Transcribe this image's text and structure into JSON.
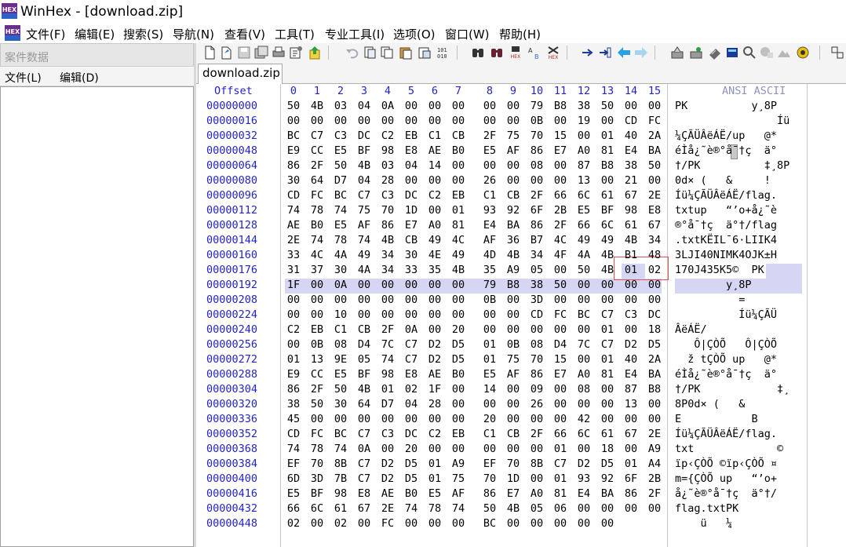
{
  "app": {
    "title": "WinHex - [download.zip]"
  },
  "menu": [
    {
      "name": "menu-file",
      "label": "文件(F)",
      "underline": "F"
    },
    {
      "name": "menu-edit",
      "label": "编辑(E)",
      "underline": "E"
    },
    {
      "name": "menu-search",
      "label": "搜索(S)",
      "underline": "S"
    },
    {
      "name": "menu-navigation",
      "label": "导航(N)",
      "underline": "N"
    },
    {
      "name": "menu-view",
      "label": "查看(V)",
      "underline": "V"
    },
    {
      "name": "menu-tools",
      "label": "工具(T)",
      "underline": "T"
    },
    {
      "name": "menu-specialist",
      "label": "专业工具(I)",
      "underline": "I"
    },
    {
      "name": "menu-options",
      "label": "选项(O)",
      "underline": "O"
    },
    {
      "name": "menu-window",
      "label": "窗口(W)",
      "underline": "W"
    },
    {
      "name": "menu-help",
      "label": "帮助(H)",
      "underline": "H"
    }
  ],
  "case_panel": {
    "caption": "案件数据",
    "menu_file": "文件(L)",
    "menu_edit": "编辑(D)"
  },
  "tab": {
    "label": "download.zip"
  },
  "hex": {
    "offset_header": "Offset",
    "column_headers": [
      "0",
      "1",
      "2",
      "3",
      "4",
      "5",
      "6",
      "7",
      "8",
      "9",
      "10",
      "11",
      "12",
      "13",
      "14",
      "15"
    ],
    "ascii_header": "ANSI ASCII",
    "rows": [
      {
        "offset": "00000000",
        "bytes": [
          "50",
          "4B",
          "03",
          "04",
          "0A",
          "00",
          "00",
          "00",
          "00",
          "00",
          "79",
          "B8",
          "38",
          "50",
          "00",
          "00"
        ],
        "ascii": "PK          y¸8P  "
      },
      {
        "offset": "00000016",
        "bytes": [
          "00",
          "00",
          "00",
          "00",
          "00",
          "00",
          "00",
          "00",
          "00",
          "00",
          "0B",
          "00",
          "19",
          "00",
          "CD",
          "FC"
        ],
        "ascii": "                Íü"
      },
      {
        "offset": "00000032",
        "bytes": [
          "BC",
          "C7",
          "C3",
          "DC",
          "C2",
          "EB",
          "C1",
          "CB",
          "2F",
          "75",
          "70",
          "15",
          "00",
          "01",
          "40",
          "2A"
        ],
        "ascii": "¼ÇÃÜÂëÁË/up   @*"
      },
      {
        "offset": "00000048",
        "bytes": [
          "E9",
          "CC",
          "E5",
          "BF",
          "98",
          "E8",
          "AE",
          "B0",
          "E5",
          "AF",
          "86",
          "E7",
          "A0",
          "81",
          "E4",
          "BA"
        ],
        "ascii": "éÌå¿˜è®°å¯†ç  ä°"
      },
      {
        "offset": "00000064",
        "bytes": [
          "86",
          "2F",
          "50",
          "4B",
          "03",
          "04",
          "14",
          "00",
          "00",
          "00",
          "08",
          "00",
          "87",
          "B8",
          "38",
          "50"
        ],
        "ascii": "†/PK          ‡¸8P"
      },
      {
        "offset": "00000080",
        "bytes": [
          "30",
          "64",
          "D7",
          "04",
          "28",
          "00",
          "00",
          "00",
          "26",
          "00",
          "00",
          "00",
          "13",
          "00",
          "21",
          "00"
        ],
        "ascii": "0d× (   &     !"
      },
      {
        "offset": "00000096",
        "bytes": [
          "CD",
          "FC",
          "BC",
          "C7",
          "C3",
          "DC",
          "C2",
          "EB",
          "C1",
          "CB",
          "2F",
          "66",
          "6C",
          "61",
          "67",
          "2E"
        ],
        "ascii": "Íü¼ÇÃÜÂëÁË/flag."
      },
      {
        "offset": "00000112",
        "bytes": [
          "74",
          "78",
          "74",
          "75",
          "70",
          "1D",
          "00",
          "01",
          "93",
          "92",
          "6F",
          "2B",
          "E5",
          "BF",
          "98",
          "E8"
        ],
        "ascii": "txtup   “’o+å¿˜è"
      },
      {
        "offset": "00000128",
        "bytes": [
          "AE",
          "B0",
          "E5",
          "AF",
          "86",
          "E7",
          "A0",
          "81",
          "E4",
          "BA",
          "86",
          "2F",
          "66",
          "6C",
          "61",
          "67"
        ],
        "ascii": "®°å¯†ç  ä°†/flag"
      },
      {
        "offset": "00000144",
        "bytes": [
          "2E",
          "74",
          "78",
          "74",
          "4B",
          "CB",
          "49",
          "4C",
          "AF",
          "36",
          "B7",
          "4C",
          "49",
          "49",
          "4B",
          "34"
        ],
        "ascii": ".txtKËIL¯6·LIIK4"
      },
      {
        "offset": "00000160",
        "bytes": [
          "33",
          "4C",
          "4A",
          "49",
          "34",
          "30",
          "4E",
          "49",
          "4D",
          "4B",
          "34",
          "4F",
          "4A",
          "4B",
          "B1",
          "48"
        ],
        "ascii": "3LJI40NIMK4OJK±H"
      },
      {
        "offset": "00000176",
        "bytes": [
          "31",
          "37",
          "30",
          "4A",
          "34",
          "33",
          "35",
          "4B",
          "35",
          "A9",
          "05",
          "00",
          "50",
          "4B",
          "01",
          "02"
        ],
        "ascii": "170J435K5©  PK  "
      },
      {
        "offset": "00000192",
        "bytes": [
          "1F",
          "00",
          "0A",
          "00",
          "00",
          "00",
          "00",
          "00",
          "79",
          "B8",
          "38",
          "50",
          "00",
          "00",
          "00",
          "00"
        ],
        "ascii": "        y¸8P    "
      },
      {
        "offset": "00000208",
        "bytes": [
          "00",
          "00",
          "00",
          "00",
          "00",
          "00",
          "00",
          "00",
          "0B",
          "00",
          "3D",
          "00",
          "00",
          "00",
          "00",
          "00"
        ],
        "ascii": "          =     "
      },
      {
        "offset": "00000224",
        "bytes": [
          "00",
          "00",
          "10",
          "00",
          "00",
          "00",
          "00",
          "00",
          "00",
          "00",
          "CD",
          "FC",
          "BC",
          "C7",
          "C3",
          "DC"
        ],
        "ascii": "          Íü¼ÇÃÜ"
      },
      {
        "offset": "00000240",
        "bytes": [
          "C2",
          "EB",
          "C1",
          "CB",
          "2F",
          "0A",
          "00",
          "20",
          "00",
          "00",
          "00",
          "00",
          "00",
          "01",
          "00",
          "18"
        ],
        "ascii": "ÂëÁË/           "
      },
      {
        "offset": "00000256",
        "bytes": [
          "00",
          "0B",
          "08",
          "D4",
          "7C",
          "C7",
          "D2",
          "D5",
          "01",
          "0B",
          "08",
          "D4",
          "7C",
          "C7",
          "D2",
          "D5"
        ],
        "ascii": "   Ô|ÇÒÕ   Ô|ÇÒÕ"
      },
      {
        "offset": "00000272",
        "bytes": [
          "01",
          "13",
          "9E",
          "05",
          "74",
          "C7",
          "D2",
          "D5",
          "01",
          "75",
          "70",
          "15",
          "00",
          "01",
          "40",
          "2A"
        ],
        "ascii": "  ž tÇÒÕ up   @*"
      },
      {
        "offset": "00000288",
        "bytes": [
          "E9",
          "CC",
          "E5",
          "BF",
          "98",
          "E8",
          "AE",
          "B0",
          "E5",
          "AF",
          "86",
          "E7",
          "A0",
          "81",
          "E4",
          "BA"
        ],
        "ascii": "éÌå¿˜è®°å¯†ç  ä°"
      },
      {
        "offset": "00000304",
        "bytes": [
          "86",
          "2F",
          "50",
          "4B",
          "01",
          "02",
          "1F",
          "00",
          "14",
          "00",
          "09",
          "00",
          "08",
          "00",
          "87",
          "B8"
        ],
        "ascii": "†/PK            ‡¸"
      },
      {
        "offset": "00000320",
        "bytes": [
          "38",
          "50",
          "30",
          "64",
          "D7",
          "04",
          "28",
          "00",
          "00",
          "00",
          "26",
          "00",
          "00",
          "00",
          "13",
          "00"
        ],
        "ascii": "8P0d× (   &     "
      },
      {
        "offset": "00000336",
        "bytes": [
          "45",
          "00",
          "00",
          "00",
          "00",
          "00",
          "00",
          "00",
          "20",
          "00",
          "00",
          "00",
          "42",
          "00",
          "00",
          "00"
        ],
        "ascii": "E           B   "
      },
      {
        "offset": "00000352",
        "bytes": [
          "CD",
          "FC",
          "BC",
          "C7",
          "C3",
          "DC",
          "C2",
          "EB",
          "C1",
          "CB",
          "2F",
          "66",
          "6C",
          "61",
          "67",
          "2E"
        ],
        "ascii": "Íü¼ÇÃÜÂëÁË/flag."
      },
      {
        "offset": "00000368",
        "bytes": [
          "74",
          "78",
          "74",
          "0A",
          "00",
          "20",
          "00",
          "00",
          "00",
          "00",
          "00",
          "01",
          "00",
          "18",
          "00",
          "A9"
        ],
        "ascii": "txt             ©"
      },
      {
        "offset": "00000384",
        "bytes": [
          "EF",
          "70",
          "8B",
          "C7",
          "D2",
          "D5",
          "01",
          "A9",
          "EF",
          "70",
          "8B",
          "C7",
          "D2",
          "D5",
          "01",
          "A4"
        ],
        "ascii": "ïp‹ÇÒÕ ©ïp‹ÇÒÕ ¤"
      },
      {
        "offset": "00000400",
        "bytes": [
          "6D",
          "3D",
          "7B",
          "C7",
          "D2",
          "D5",
          "01",
          "75",
          "70",
          "1D",
          "00",
          "01",
          "93",
          "92",
          "6F",
          "2B"
        ],
        "ascii": "m={ÇÒÕ up   “’o+"
      },
      {
        "offset": "00000416",
        "bytes": [
          "E5",
          "BF",
          "98",
          "E8",
          "AE",
          "B0",
          "E5",
          "AF",
          "86",
          "E7",
          "A0",
          "81",
          "E4",
          "BA",
          "86",
          "2F"
        ],
        "ascii": "å¿˜è®°å¯†ç  ä°†/"
      },
      {
        "offset": "00000432",
        "bytes": [
          "66",
          "6C",
          "61",
          "67",
          "2E",
          "74",
          "78",
          "74",
          "50",
          "4B",
          "05",
          "06",
          "00",
          "00",
          "00",
          "00"
        ],
        "ascii": "flag.txtPK      "
      },
      {
        "offset": "00000448",
        "bytes": [
          "02",
          "00",
          "02",
          "00",
          "FC",
          "00",
          "00",
          "00",
          "BC",
          "00",
          "00",
          "00",
          "00",
          "00"
        ],
        "ascii": "    ü   ¼     "
      }
    ]
  },
  "colors": {
    "offset_text": "#2323c8",
    "selection": "#d6d6f4",
    "highlight_box": "#e05050"
  },
  "icons": [
    "new-file-icon",
    "open-file-icon",
    "save-icon",
    "print-icon",
    "properties-icon",
    "undo-icon",
    "copy-icon",
    "paste-icon",
    "find-icon",
    "replace-icon",
    "hex-search-icon",
    "goto-offset-icon",
    "back-icon",
    "forward-icon",
    "disk-icon",
    "ram-icon",
    "calculator-icon",
    "settings-icon"
  ]
}
